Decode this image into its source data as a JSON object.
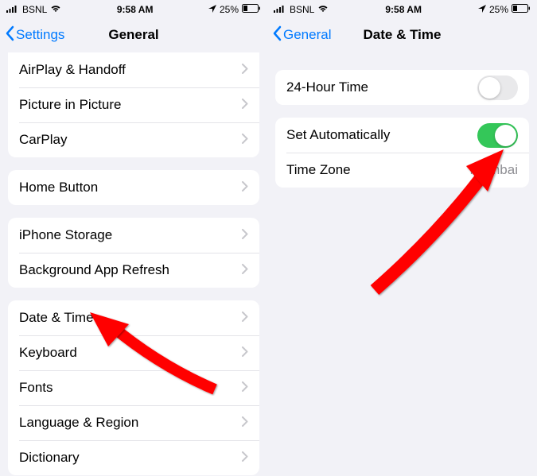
{
  "left": {
    "status": {
      "carrier": "BSNL",
      "time": "9:58 AM",
      "battery": "25%"
    },
    "nav": {
      "back": "Settings",
      "title": "General"
    },
    "groups": [
      {
        "items": [
          {
            "label": "AirPlay & Handoff"
          },
          {
            "label": "Picture in Picture"
          },
          {
            "label": "CarPlay"
          }
        ]
      },
      {
        "items": [
          {
            "label": "Home Button"
          }
        ]
      },
      {
        "items": [
          {
            "label": "iPhone Storage"
          },
          {
            "label": "Background App Refresh"
          }
        ]
      },
      {
        "items": [
          {
            "label": "Date & Time"
          },
          {
            "label": "Keyboard"
          },
          {
            "label": "Fonts"
          },
          {
            "label": "Language & Region"
          },
          {
            "label": "Dictionary"
          }
        ]
      }
    ]
  },
  "right": {
    "status": {
      "carrier": "BSNL",
      "time": "9:58 AM",
      "battery": "25%"
    },
    "nav": {
      "back": "General",
      "title": "Date & Time"
    },
    "rows": {
      "twentyFourHour": {
        "label": "24-Hour Time",
        "on": false
      },
      "setAuto": {
        "label": "Set Automatically",
        "on": true
      },
      "timeZone": {
        "label": "Time Zone",
        "value": "Mumbai"
      }
    }
  }
}
